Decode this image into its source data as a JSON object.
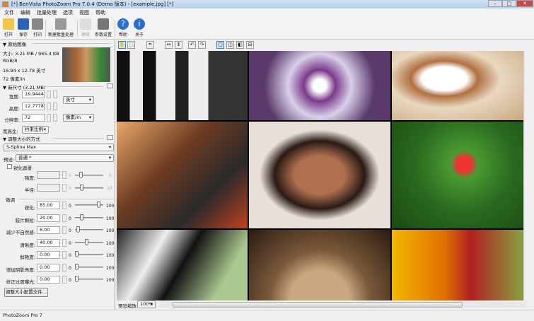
{
  "window": {
    "title": "[*] BenVista PhotoZoom Pro 7.0.4 (Demo 版本) - [example.jpg] [*]"
  },
  "menu": [
    "文件",
    "编辑",
    "批量处理",
    "选项",
    "视图",
    "帮助"
  ],
  "toolbar": {
    "open": "打开",
    "save": "保存",
    "print": "打印",
    "batch": "新建批量处理",
    "preview": "预览",
    "settings": "参数设置",
    "help": "帮助",
    "about": "关于"
  },
  "original": {
    "header": "原始图像",
    "size": "大小: 3.21 MB / 965.4 KB",
    "mode": "RGB/8",
    "dims": "16.94 x 12.78 英寸",
    "res": "72 像素/in"
  },
  "newsize": {
    "header": "新尺寸 (3.21 MB)",
    "width_label": "宽度:",
    "width": "16.9444",
    "height_label": "高度:",
    "height": "12.7778",
    "res_label": "分辨率:",
    "res": "72",
    "unit": "英寸",
    "res_unit": "像素/in",
    "aspect_label": "宽高比:",
    "aspect": "约束比例"
  },
  "method": {
    "header": "调整大小的方式",
    "algorithm": "S-Spline Max",
    "preset_label": "预设:",
    "preset": "普通 *"
  },
  "unsharp": {
    "label": "锐化遮罩",
    "strength_label": "强度:",
    "strength_min": "0",
    "strength_max": "5",
    "radius_label": "半径:",
    "radius_min": "0",
    "radius_max": "10"
  },
  "finetune": {
    "label": "微调",
    "rows": [
      {
        "label": "锐化:",
        "value": "85.00",
        "min": "0",
        "max": "100",
        "pct": 85
      },
      {
        "label": "胶片颗粒:",
        "value": "20.00",
        "min": "0",
        "max": "100",
        "pct": 20
      },
      {
        "label": "减少不自然感:",
        "value": "6.00",
        "min": "0",
        "max": "100",
        "pct": 6
      },
      {
        "label": "清晰度:",
        "value": "40.00",
        "min": "0",
        "max": "100",
        "pct": 40
      },
      {
        "label": "鲜艳度:",
        "value": "0.00",
        "min": "0",
        "max": "100",
        "pct": 0
      },
      {
        "label": "增加阴影亮度:",
        "value": "0.00",
        "min": "0",
        "max": "100",
        "pct": 0
      },
      {
        "label": "修正过度曝光:",
        "value": "0.00",
        "min": "0",
        "max": "100",
        "pct": 0
      }
    ]
  },
  "profile_button": "调整大小配置文件...",
  "preview": {
    "zoom_label": "预览缩放:",
    "zoom": "100%"
  },
  "status": "PhotoZoom Pro 7"
}
